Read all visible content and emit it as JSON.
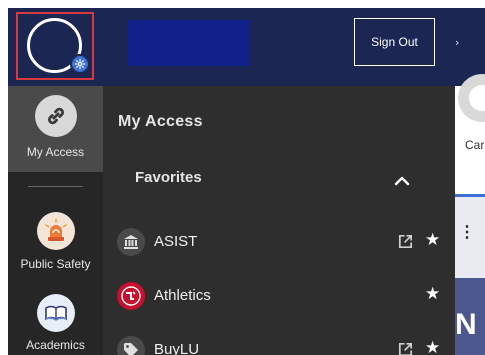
{
  "header": {
    "signout_label": "Sign Out",
    "collapse_glyph": "›"
  },
  "rail": {
    "items": [
      {
        "label": "My Access",
        "icon": "link-icon",
        "active": true
      },
      {
        "label": "Public Safety",
        "icon": "siren-icon",
        "active": false
      },
      {
        "label": "Academics",
        "icon": "book-icon",
        "active": false
      }
    ]
  },
  "drawer": {
    "title": "My Access",
    "favorites_label": "Favorites",
    "favorites_expanded": true,
    "items": [
      {
        "label": "ASIST",
        "icon": "bank-icon",
        "external": true,
        "starred": true
      },
      {
        "label": "Athletics",
        "icon": "athletics-logo-icon",
        "external": false,
        "starred": true
      },
      {
        "label": "BuyLU",
        "icon": "tag-icon",
        "external": true,
        "starred": true
      }
    ],
    "star_glyph": "★"
  },
  "background": {
    "tile_label": "Car",
    "hero_letter": "N",
    "menu_glyph": "⋮"
  },
  "colors": {
    "header_bg": "#1b2653",
    "logo_block": "#10218c",
    "rail_bg": "#262626",
    "drawer_bg": "#2e2e2e",
    "accent_blue": "#3b6dd8",
    "highlight_red": "#d63a3a"
  }
}
